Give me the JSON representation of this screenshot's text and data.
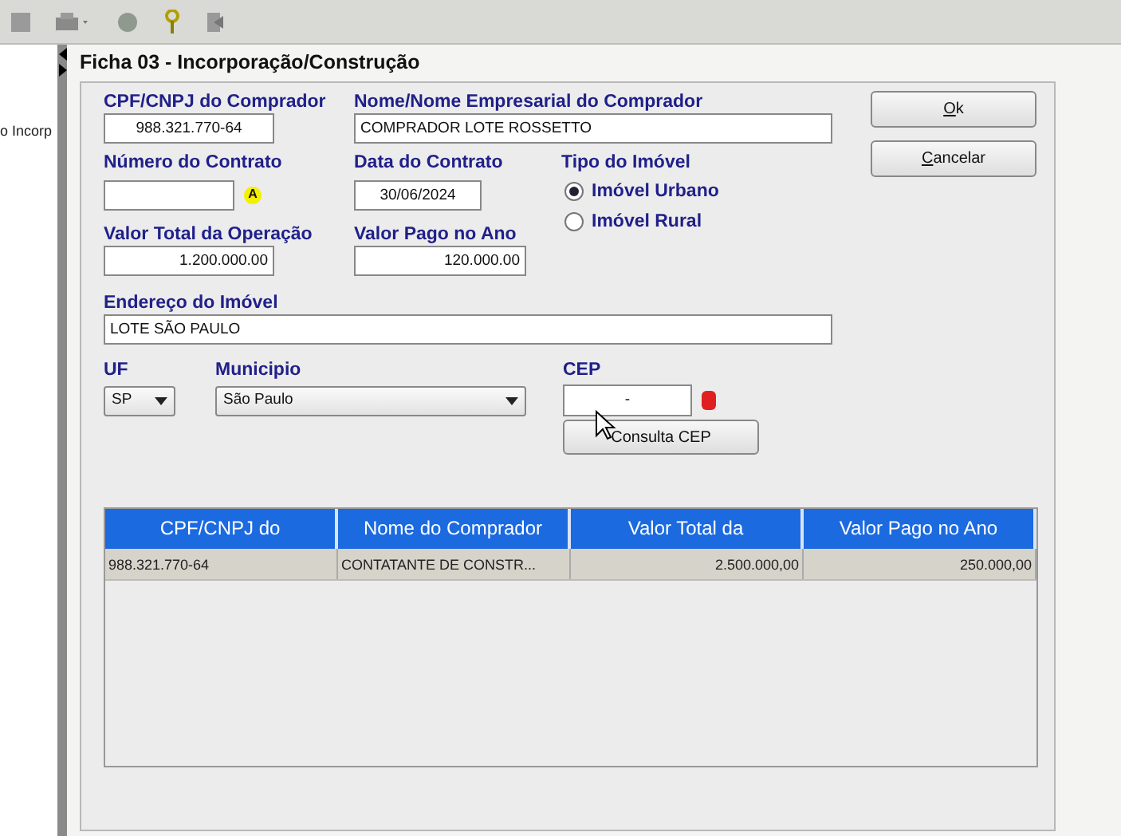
{
  "side_panel": {
    "text": "o Incorp"
  },
  "window": {
    "title": "Ficha 03 - Incorporação/Construção"
  },
  "form": {
    "cpf": {
      "label": "CPF/CNPJ do Comprador",
      "value": "988.321.770-64"
    },
    "nome": {
      "label": "Nome/Nome Empresarial do Comprador",
      "value": "COMPRADOR LOTE ROSSETTO"
    },
    "numero": {
      "label": "Número do Contrato",
      "badge": "A"
    },
    "data": {
      "label": "Data do Contrato",
      "value": "30/06/2024"
    },
    "tipo": {
      "label": "Tipo do Imóvel",
      "options": [
        {
          "label": "Imóvel Urbano",
          "selected": true
        },
        {
          "label": "Imóvel Rural",
          "selected": false
        }
      ]
    },
    "valor_total": {
      "label": "Valor Total da Operação",
      "value": "1.200.000.00"
    },
    "valor_pago": {
      "label": "Valor Pago no Ano",
      "value": "120.000.00"
    },
    "endereco": {
      "label": "Endereço do Imóvel",
      "value": "LOTE SÃO PAULO"
    },
    "uf": {
      "label": "UF",
      "value": "SP"
    },
    "municipio": {
      "label": "Municipio",
      "value": "São Paulo"
    },
    "cep": {
      "label": "CEP",
      "value": "-",
      "button": "Consulta CEP"
    }
  },
  "buttons": [
    {
      "mnemonic": "O",
      "rest": "k"
    },
    {
      "mnemonic": "C",
      "rest": "ancelar"
    }
  ],
  "table": {
    "columns": [
      "CPF/CNPJ do",
      "Nome do Comprador",
      "Valor Total da",
      "Valor Pago no Ano"
    ],
    "rows": [
      [
        "988.321.770-64",
        "CONTATANTE DE CONSTR...",
        "2.500.000,00",
        "250.000,00"
      ]
    ]
  }
}
